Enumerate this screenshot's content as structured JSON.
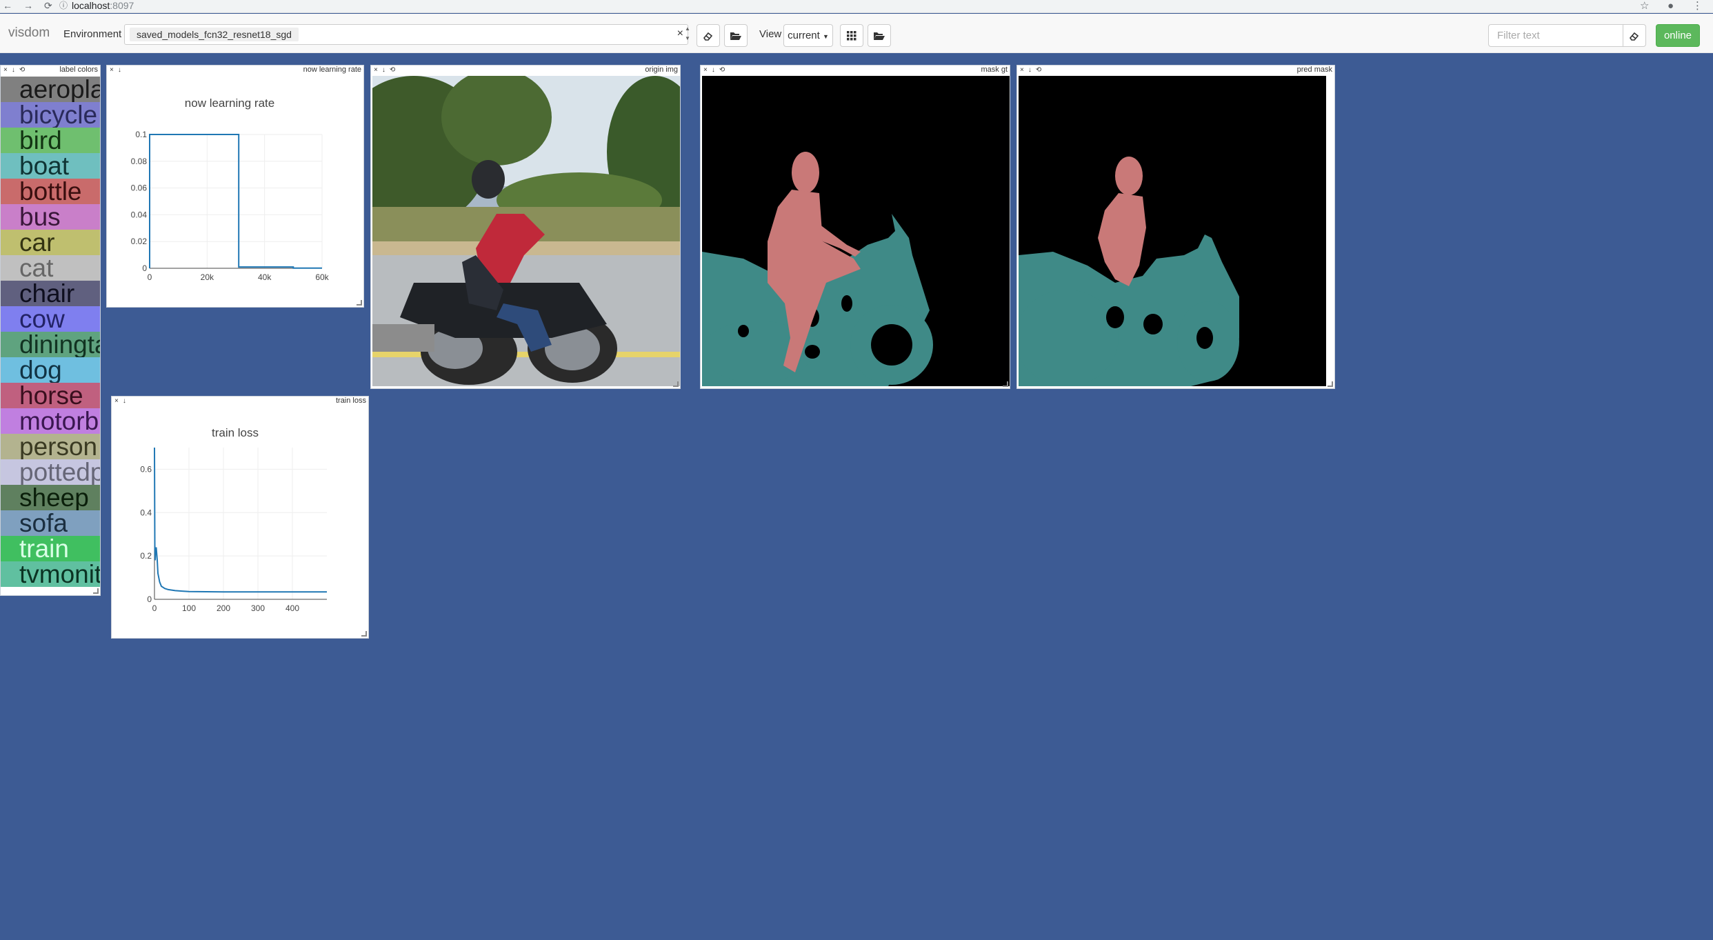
{
  "browser": {
    "url_host": "localhost",
    "url_port": ":8097"
  },
  "toolbar": {
    "brand": "visdom",
    "environment_label": "Environment",
    "environment_value": "saved_models_fcn32_resnet18_sgd",
    "view_label": "View",
    "view_value": "current",
    "filter_placeholder": "Filter text",
    "status_button": "online"
  },
  "colors": {
    "background": "#3d5b94",
    "online_green": "#5cb85c",
    "line_blue": "#1f77b4",
    "mask_person": "#c97978",
    "mask_motorbike": "#3f8a87"
  },
  "panes": {
    "label_colors": {
      "title": "label colors",
      "labels": [
        {
          "text": "aeroplane",
          "bg": "#808080",
          "fg": "#1a1a1a"
        },
        {
          "text": "bicycle",
          "bg": "#7f7fcf",
          "fg": "#2a2a5a"
        },
        {
          "text": "bird",
          "bg": "#6fbf6f",
          "fg": "#123412"
        },
        {
          "text": "boat",
          "bg": "#6fbfbf",
          "fg": "#0f3434"
        },
        {
          "text": "bottle",
          "bg": "#c96b6b",
          "fg": "#3a0f0f"
        },
        {
          "text": "bus",
          "bg": "#c97fc9",
          "fg": "#3a173a"
        },
        {
          "text": "car",
          "bg": "#bfbf6f",
          "fg": "#343412"
        },
        {
          "text": "cat",
          "bg": "#c0c0c0",
          "fg": "#666666"
        },
        {
          "text": "chair",
          "bg": "#60607f",
          "fg": "#0e0e1e"
        },
        {
          "text": "cow",
          "bg": "#7f7fef",
          "fg": "#232366"
        },
        {
          "text": "diningtable",
          "bg": "#5fa37f",
          "fg": "#123322"
        },
        {
          "text": "dog",
          "bg": "#6fbfe0",
          "fg": "#113344"
        },
        {
          "text": "horse",
          "bg": "#c0607f",
          "fg": "#3a0f1e"
        },
        {
          "text": "motorbike",
          "bg": "#c07fe0",
          "fg": "#3a1750"
        },
        {
          "text": "person",
          "bg": "#b3b38f",
          "fg": "#3a3a22"
        },
        {
          "text": "pottedplant",
          "bg": "#c6c6e0",
          "fg": "#666677"
        },
        {
          "text": "sheep",
          "bg": "#5f805f",
          "fg": "#0b1f0b"
        },
        {
          "text": "sofa",
          "bg": "#7fa0bf",
          "fg": "#1b2f40"
        },
        {
          "text": "train",
          "bg": "#40bf60",
          "fg": "#d9ffe6"
        },
        {
          "text": "tvmonitor",
          "bg": "#60c0a0",
          "fg": "#0b3323"
        }
      ]
    },
    "lr": {
      "title": "now learning rate"
    },
    "origin": {
      "title": "origin img"
    },
    "mask_gt": {
      "title": "mask gt"
    },
    "pred_mask": {
      "title": "pred mask"
    },
    "loss": {
      "title": "train loss"
    },
    "controls": [
      "×",
      "↓",
      "⟲"
    ]
  },
  "chart_data": [
    {
      "type": "line",
      "title": "now learning rate",
      "xlabel": "",
      "ylabel": "",
      "xlim": [
        0,
        60000
      ],
      "ylim": [
        0,
        0.1
      ],
      "xticks": [
        "0",
        "20k",
        "40k",
        "60k"
      ],
      "xtick_values": [
        0,
        20000,
        40000,
        60000
      ],
      "yticks": [
        "0",
        "0.02",
        "0.04",
        "0.06",
        "0.08",
        "0.1"
      ],
      "ytick_values": [
        0,
        0.02,
        0.04,
        0.06,
        0.08,
        0.1
      ],
      "x": [
        0,
        0,
        31000,
        31000,
        50000,
        50000,
        60000
      ],
      "y": [
        0,
        0.1,
        0.1,
        0.001,
        0.001,
        0.0001,
        0.0001
      ],
      "grid": true
    },
    {
      "type": "line",
      "title": "train loss",
      "xlabel": "",
      "ylabel": "",
      "xlim": [
        0,
        500
      ],
      "ylim": [
        0,
        0.7
      ],
      "xticks": [
        "0",
        "100",
        "200",
        "300",
        "400"
      ],
      "xtick_values": [
        0,
        100,
        200,
        300,
        400
      ],
      "yticks": [
        "0",
        "0.2",
        "0.4",
        "0.6"
      ],
      "ytick_values": [
        0,
        0.2,
        0.4,
        0.6
      ],
      "x": [
        0,
        1,
        2,
        3,
        5,
        8,
        10,
        15,
        20,
        30,
        40,
        60,
        80,
        100,
        150,
        200,
        300,
        400,
        500
      ],
      "y": [
        0.7,
        0.25,
        0.18,
        0.22,
        0.24,
        0.18,
        0.12,
        0.08,
        0.06,
        0.05,
        0.045,
        0.04,
        0.038,
        0.036,
        0.035,
        0.034,
        0.034,
        0.034,
        0.034
      ],
      "grid": true
    }
  ]
}
